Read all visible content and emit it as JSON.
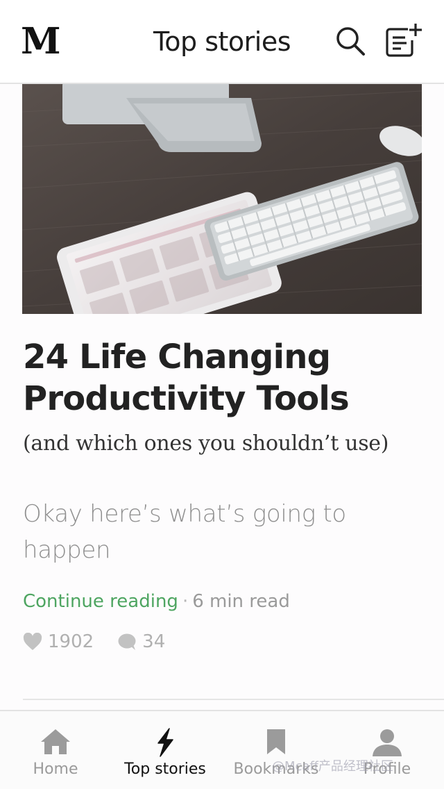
{
  "header": {
    "logo": "M",
    "title": "Top stories",
    "search_icon": "search-icon",
    "compose_icon": "new-story-icon"
  },
  "article": {
    "hero_image": "desk with tablet calendar, keyboard and monitor",
    "title": "24 Life Changing Productivity Tools",
    "subtitle": "(and which ones you shouldn’t use)",
    "snippet": "Okay here’s what’s going to happen",
    "continue_label": "Continue reading",
    "separator": "·",
    "read_time": "6 min read",
    "likes": "1902",
    "comments": "34"
  },
  "tabbar": {
    "tabs": [
      {
        "label": "Home",
        "icon": "home-icon",
        "active": false
      },
      {
        "label": "Top stories",
        "icon": "lightning-icon",
        "active": true
      },
      {
        "label": "Bookmarks",
        "icon": "bookmark-icon",
        "active": false
      },
      {
        "label": "Profile",
        "icon": "profile-icon",
        "active": false
      }
    ]
  },
  "watermark": "@Mcaff产品经理社区",
  "colors": {
    "accent_green": "#4ea561",
    "text_dark": "#222222",
    "text_muted": "#9a9a9a"
  }
}
